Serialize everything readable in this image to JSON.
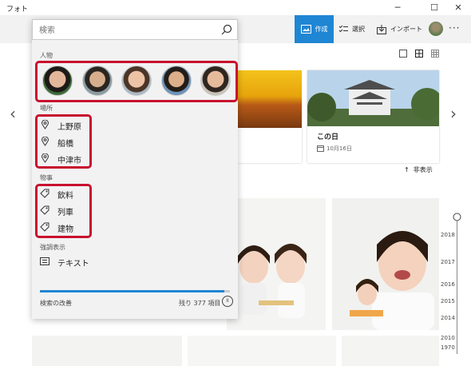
{
  "window": {
    "title": "フォト",
    "minimize": "─",
    "maximize": "☐",
    "close": "✕"
  },
  "commandbar": {
    "create_label": "作成",
    "select_label": "選択",
    "import_label": "インポート",
    "more_label": "···"
  },
  "search": {
    "placeholder": "検索",
    "sections": {
      "people": "人物",
      "places": "場所",
      "things": "物事",
      "emphasis": "強調表示"
    },
    "places": [
      "上野原",
      "船橋",
      "中津市"
    ],
    "things": [
      "飲料",
      "列車",
      "建物"
    ],
    "emphasis_items": [
      "テキスト"
    ],
    "footer_status": "検索の改善",
    "footer_remaining": "残り 377 項目",
    "progress_fraction": 0.97
  },
  "gallery": {
    "card_title": "この日",
    "card_date": "10月16日",
    "hide_label": "非表示",
    "timeline_years": [
      "2018",
      "2017",
      "2016",
      "2015",
      "2014",
      "2010",
      "1970"
    ]
  },
  "colors": {
    "accent": "#1f86d4",
    "highlight": "#c8102e",
    "panel_bg": "#f2f2f2"
  }
}
